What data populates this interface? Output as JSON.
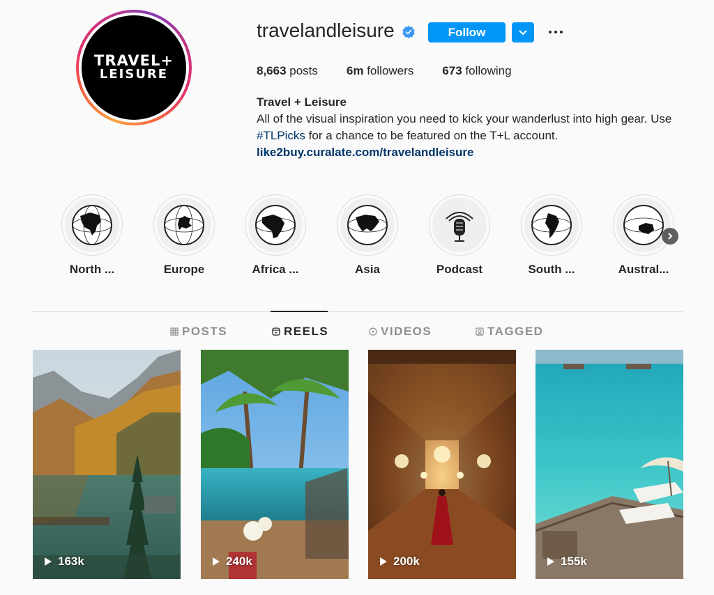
{
  "profile": {
    "avatar_text_line1": "TRAVEL+",
    "avatar_text_line2": "LEISURE",
    "username": "travelandleisure",
    "follow_label": "Follow",
    "stats": {
      "posts_count": "8,663",
      "posts_label": " posts",
      "followers_count": "6m",
      "followers_label": " followers",
      "following_count": "673",
      "following_label": " following"
    },
    "bio": {
      "name": "Travel + Leisure",
      "text_part1": "All of the visual inspiration you need to kick your wanderlust into high gear. Use ",
      "hashtag": "#TLPicks",
      "text_part2": " for a chance to be featured on the T+L account.",
      "link": "like2buy.curalate.com/travelandleisure"
    }
  },
  "highlights": [
    {
      "label": "North ...",
      "icon": "globe-north-america-icon"
    },
    {
      "label": "Europe",
      "icon": "globe-europe-icon"
    },
    {
      "label": "Africa ...",
      "icon": "globe-africa-icon"
    },
    {
      "label": "Asia",
      "icon": "globe-asia-icon"
    },
    {
      "label": "Podcast",
      "icon": "microphone-icon"
    },
    {
      "label": "South ...",
      "icon": "globe-south-america-icon"
    },
    {
      "label": "Austral...",
      "icon": "globe-australia-icon"
    }
  ],
  "tabs": [
    {
      "label": "POSTS",
      "icon": "grid-icon",
      "active": false
    },
    {
      "label": "REELS",
      "icon": "reels-icon",
      "active": true
    },
    {
      "label": "VIDEOS",
      "icon": "play-circle-icon",
      "active": false
    },
    {
      "label": "TAGGED",
      "icon": "tagged-icon",
      "active": false
    }
  ],
  "reels": [
    {
      "views": "163k",
      "scene": "mountain lake with boats"
    },
    {
      "views": "240k",
      "scene": "tropical infinity pool"
    },
    {
      "views": "200k",
      "scene": "hall of mirrors"
    },
    {
      "views": "155k",
      "scene": "turquoise ocean villa"
    }
  ],
  "colors": {
    "accent": "#0095f6",
    "link": "#00376b",
    "text": "#262626",
    "muted": "#8e8e8e",
    "background": "#fafafa"
  }
}
